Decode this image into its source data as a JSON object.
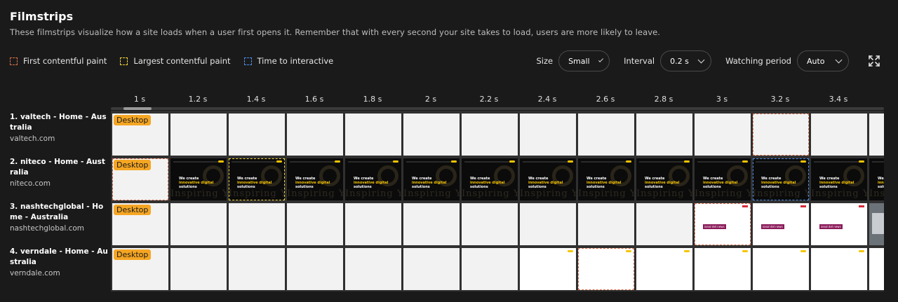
{
  "header": {
    "title": "Filmstrips",
    "subtitle": "These filmstrips visualize how a site loads when a user first opens it. Remember that with every second your site takes to load, users are more likely to leave."
  },
  "legend": [
    {
      "label": "First contentful paint",
      "color": "#d96d4b"
    },
    {
      "label": "Largest contentful paint",
      "color": "#f2d23a"
    },
    {
      "label": "Time to interactive",
      "color": "#4f8be6"
    }
  ],
  "controls": {
    "size_label": "Size",
    "size_value": "Small",
    "interval_label": "Interval",
    "interval_value": "0.2 s",
    "watching_label": "Watching period",
    "watching_value": "Auto"
  },
  "timeline": [
    "1 s",
    "1.2 s",
    "1.4 s",
    "1.6 s",
    "1.8 s",
    "2 s",
    "2.2 s",
    "2.4 s",
    "2.6 s",
    "2.8 s",
    "3 s",
    "3.2 s",
    "3.4 s"
  ],
  "badge_label": "Desktop",
  "thumb": {
    "line1": "We create",
    "line2": "innovative digital",
    "line3": "solutions",
    "deco": "Inspiring Your Ambition",
    "tag": "ional del news"
  },
  "rows": [
    {
      "name": "1. valtech - Home - Australia",
      "url": "valtech.com"
    },
    {
      "name": "2. niteco - Home - Australia",
      "url": "niteco.com"
    },
    {
      "name": "3. nashtechglobal - Home - Australia",
      "url": "nashtechglobal.com"
    },
    {
      "name": "4. verndale - Home - Australia",
      "url": "verndale.com"
    }
  ],
  "colors": {
    "background": "#1a1a1a",
    "badge": "#f5a623",
    "fcp": "#d96d4b",
    "lcp": "#f2d23a",
    "tti": "#4f8be6"
  }
}
